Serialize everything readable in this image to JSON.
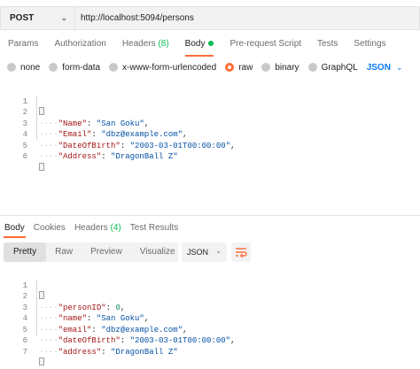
{
  "request": {
    "method": "POST",
    "url": "http://localhost:5094/persons"
  },
  "request_tabs": [
    {
      "label": "Params"
    },
    {
      "label": "Authorization"
    },
    {
      "label": "Headers",
      "count": "(8)"
    },
    {
      "label": "Body",
      "active": true
    },
    {
      "label": "Pre-request Script"
    },
    {
      "label": "Tests"
    },
    {
      "label": "Settings"
    }
  ],
  "body_types": [
    {
      "label": "none"
    },
    {
      "label": "form-data"
    },
    {
      "label": "x-www-form-urlencoded"
    },
    {
      "label": "raw",
      "selected": true
    },
    {
      "label": "binary"
    },
    {
      "label": "GraphQL"
    }
  ],
  "body_language": "JSON",
  "request_body": {
    "line_numbers": [
      "1",
      "2",
      "3",
      "4",
      "5",
      "6"
    ],
    "lines": [
      "{",
      "\"Name\": \"San Goku\",",
      "\"Email\": \"dbz@example.com\",",
      "\"DateOfBirth\": \"2003-03-01T00:00:00\",",
      "\"Address\": \"DragonBall Z\"",
      "}"
    ]
  },
  "response_tabs": [
    {
      "label": "Body",
      "active": true
    },
    {
      "label": "Cookies"
    },
    {
      "label": "Headers",
      "count": "(4)"
    },
    {
      "label": "Test Results"
    }
  ],
  "response_views": [
    "Pretty",
    "Raw",
    "Preview",
    "Visualize"
  ],
  "response_format": "JSON",
  "response_body": {
    "line_numbers": [
      "1",
      "2",
      "3",
      "4",
      "5",
      "6",
      "7"
    ],
    "lines": [
      "{",
      "\"personID\": 0,",
      "\"name\": \"San Goku\",",
      "\"email\": \"dbz@example.com\",",
      "\"dateOfBirth\": \"2003-03-01T00:00:00\",",
      "\"address\": \"DragonBall Z\"",
      "}"
    ]
  },
  "colors": {
    "accent": "#ff6c37",
    "count_green": "#0cbb52",
    "link_blue": "#097bed"
  },
  "icons": {
    "method_dropdown": "chevron-down-icon",
    "language_dropdown": "chevron-down-icon",
    "wrap_lines": "wrap-lines-icon"
  }
}
